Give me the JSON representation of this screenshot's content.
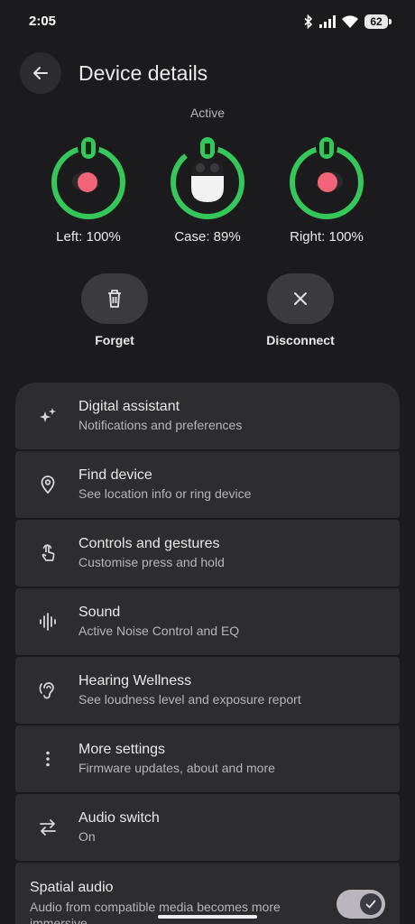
{
  "status_bar": {
    "time": "2:05",
    "battery": "62"
  },
  "header": {
    "title": "Device details"
  },
  "connection_state": "Active",
  "devices": [
    {
      "label": "Left: 100%",
      "level": 1.0
    },
    {
      "label": "Case: 89%",
      "level": 0.89
    },
    {
      "label": "Right: 100%",
      "level": 1.0
    }
  ],
  "actions": {
    "forget": "Forget",
    "disconnect": "Disconnect"
  },
  "settings": [
    {
      "icon": "sparkle-icon",
      "title": "Digital assistant",
      "subtitle": "Notifications and preferences"
    },
    {
      "icon": "location-pin-icon",
      "title": "Find device",
      "subtitle": "See location info or ring device"
    },
    {
      "icon": "touch-gesture-icon",
      "title": "Controls and gestures",
      "subtitle": "Customise press and hold"
    },
    {
      "icon": "sound-wave-icon",
      "title": "Sound",
      "subtitle": "Active Noise Control and EQ"
    },
    {
      "icon": "hearing-icon",
      "title": "Hearing Wellness",
      "subtitle": "See loudness level and exposure report"
    },
    {
      "icon": "more-vertical-icon",
      "title": "More settings",
      "subtitle": "Firmware updates, about and more"
    },
    {
      "icon": "swap-icon",
      "title": "Audio switch",
      "subtitle": "On"
    }
  ],
  "spatial_audio": {
    "title": "Spatial audio",
    "subtitle": "Audio from compatible media becomes more immersive",
    "enabled": true
  },
  "colors": {
    "ring": "#34c759",
    "bud": "#f26477",
    "background": "#1b1b1d",
    "card": "#2d2d30"
  }
}
